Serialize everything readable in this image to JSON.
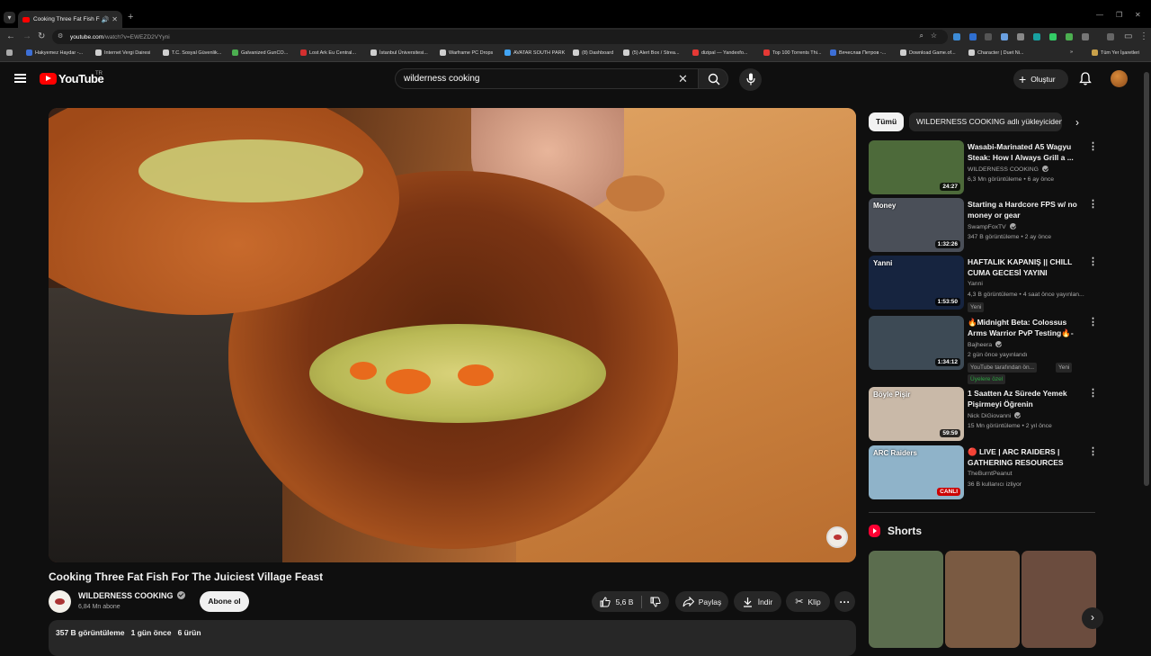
{
  "browser": {
    "tab_title": "Cooking Three Fat Fish For The Juiciest Village Feast",
    "url_host": "youtube.com",
    "url_path": "/watch?v=EWEZD2VYyni",
    "bookmarks": [
      {
        "label": "Hakyemez Haydar -...",
        "color": "#3d6fd6"
      },
      {
        "label": "Internet Vergi Dairesi",
        "color": "#cfcfcf"
      },
      {
        "label": "T.C. Sosyal Güvenlik...",
        "color": "#cfcfcf"
      },
      {
        "label": "Galvanized GunCO...",
        "color": "#4caf50"
      },
      {
        "label": "Lost Ark Eu Central...",
        "color": "#d32f2f"
      },
      {
        "label": "İstanbul Üniversitesi...",
        "color": "#cfcfcf"
      },
      {
        "label": "Warframe PC Drops",
        "color": "#cfcfcf"
      },
      {
        "label": "AVATAR SOUTH PARK",
        "color": "#42a5f5"
      },
      {
        "label": "(8) Dashboard",
        "color": "#cfcfcf"
      },
      {
        "label": "(5) Alert Box / Strea...",
        "color": "#cfcfcf"
      },
      {
        "label": "dizipal — Yandexfo...",
        "color": "#e53935"
      },
      {
        "label": "Top 100 Torrents Thi...",
        "color": "#e53935"
      },
      {
        "label": "Вячеслав Петров -...",
        "color": "#3d6fd6"
      },
      {
        "label": "Download Game.of...",
        "color": "#cfcfcf"
      },
      {
        "label": "Character | Duet Ni...",
        "color": "#cfcfcf"
      }
    ],
    "bookmarks_other": "Tüm Yer İşaretleri"
  },
  "header": {
    "logo_text": "YouTube",
    "country": "TR",
    "search_value": "wilderness cooking",
    "create_label": "Oluştur"
  },
  "video": {
    "title": "Cooking Three Fat Fish For The Juiciest Village Feast",
    "channel": "WILDERNESS COOKING",
    "subscribers": "6,84 Mn abone",
    "subscribe_label": "Abone ol",
    "likes": "5,6 B",
    "share_label": "Paylaş",
    "download_label": "İndir",
    "clip_label": "Klip",
    "views": "357 B görüntüleme",
    "age": "1 gün önce",
    "products": "6 ürün"
  },
  "sidebar": {
    "chips": [
      "Tümü",
      "WILDERNESS COOKING adlı yükleyiciden"
    ],
    "recommendations": [
      {
        "title": "Wasabi-Marinated A5 Wagyu Steak: How I Always Grill a ...",
        "channel": "WILDERNESS COOKING",
        "verified": true,
        "meta": "6,3 Mn görüntüleme • 6 ay önce",
        "duration": "24:27",
        "thumb": "#4d6a3a"
      },
      {
        "title": "Starting a Hardcore FPS w/ no money or gear",
        "channel": "SwampFoxTV",
        "verified": true,
        "meta": "347 B görüntüleme • 2 ay önce",
        "duration": "1:32:26",
        "thumb": "#4a4f58",
        "thumb_text": "Money"
      },
      {
        "title": "HAFTALIK KAPANIŞ ||\nCHILL CUMA GECESİ YAYINI",
        "channel": "Yanni",
        "verified": false,
        "meta": "4,3 B görüntüleme • 4 saat önce yayınlan...",
        "duration": "1:53:50",
        "thumb": "#16243f",
        "thumb_text": "Yanni",
        "badge": "Yeni"
      },
      {
        "title": "🔥Midnight Beta: Colossus Arms Warrior PvP Testing🔥- ...",
        "channel": "Bajheera",
        "verified": true,
        "meta": "2 gün önce yayınlandı",
        "duration": "1:34:12",
        "thumb": "#3d4a55",
        "badge": "YouTube tarafından ön...",
        "badge2": "Yeni",
        "members": "Üyelere özel"
      },
      {
        "title": "1 Saatten Az Sürede Yemek Pişirmeyi Öğrenin",
        "channel": "Nick DiGiovanni",
        "verified": true,
        "meta": "15 Mn görüntüleme • 2 yıl önce",
        "duration": "59:59",
        "thumb": "#c9b9a8",
        "thumb_text": "Böyle Pişir"
      },
      {
        "title": "🔴 LIVE | ARC RAIDERS | GATHERING RESOURCES FOR ...",
        "channel": "TheBurntPeanut",
        "verified": false,
        "meta": "36 B kullanıcı izliyor",
        "live": "CANLI",
        "thumb": "#8fb3c9",
        "thumb_text": "ARC Raiders"
      }
    ],
    "shorts_title": "Shorts",
    "shorts": [
      {
        "color": "#5b6d4e"
      },
      {
        "color": "#7a5a42"
      },
      {
        "color": "#6b4c3e"
      }
    ]
  },
  "colors": {
    "background": "#0f0f0f",
    "brand_red": "#ff0000",
    "live_red": "#cc0000"
  }
}
